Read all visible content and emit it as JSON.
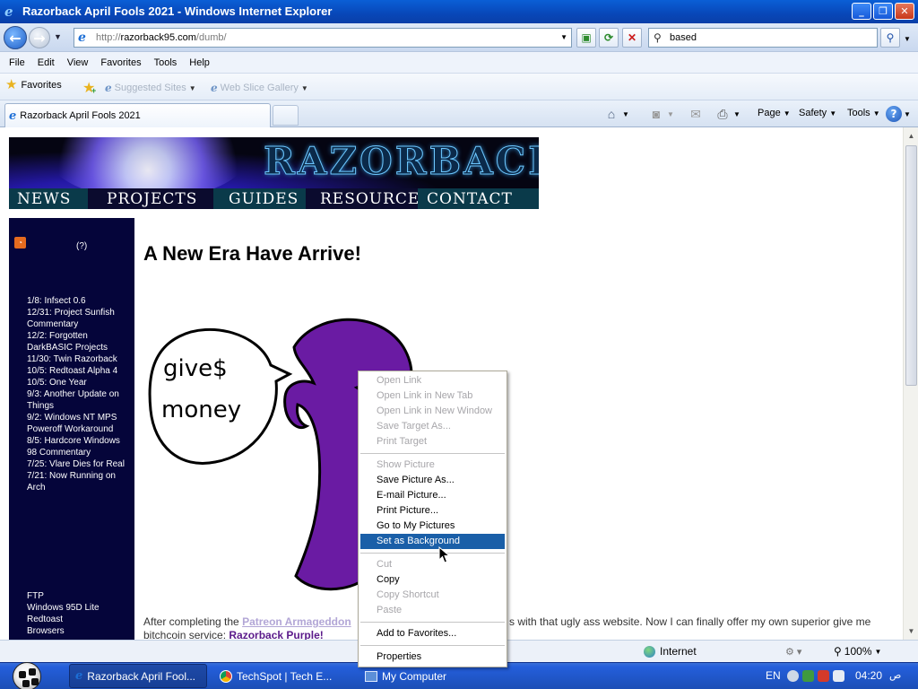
{
  "window": {
    "title": "Razorback April Fools 2021 - Windows Internet Explorer"
  },
  "address": {
    "url_prefix": "http://",
    "url_domain": "razorback95.com",
    "url_path": "/dumb/",
    "search_value": "based"
  },
  "menubar": [
    "File",
    "Edit",
    "View",
    "Favorites",
    "Tools",
    "Help"
  ],
  "favorites_bar": {
    "favorites_label": "Favorites",
    "links": [
      "Suggested Sites",
      "Web Slice Gallery"
    ]
  },
  "tab": {
    "title": "Razorback April Fools 2021"
  },
  "command_bar": {
    "page": "Page",
    "safety": "Safety",
    "tools": "Tools"
  },
  "page": {
    "banner": {
      "logo": "RAZORBACK",
      "nav": [
        "NEWS",
        "PROJECTS",
        "GUIDES",
        "RESOURCES",
        "CONTACT"
      ]
    },
    "sidebar": {
      "help": "(?)",
      "news": [
        "1/8: Infsect 0.6",
        "12/31: Project Sunfish Commentary",
        "12/2: Forgotten DarkBASIC Projects",
        "11/30: Twin Razorback",
        "10/5: Redtoast Alpha 4",
        "10/5: One Year",
        "9/3: Another Update on Things",
        "9/2: Windows NT MPS Poweroff Workaround",
        "8/5: Hardcore Windows 98 Commentary",
        "7/25: Vlare Dies for Real",
        "7/21: Now Running on Arch"
      ],
      "links": [
        "FTP",
        "Windows 95D Lite",
        "Redtoast",
        "Browsers"
      ]
    },
    "heading": "A New Era Have Arrive!",
    "comic_text": [
      "give$",
      "money"
    ],
    "paragraph": {
      "prefix": "After completing the",
      "link1": "Patreon Armageddon",
      "rest": "s with that ugly ass website. Now I can finally offer my own superior give me",
      "line2_prefix": "bitchcoin service:",
      "link2": "Razorback Purple!"
    }
  },
  "context_menu": {
    "items": [
      {
        "label": "Open Link",
        "disabled": true
      },
      {
        "label": "Open Link in New Tab",
        "disabled": true
      },
      {
        "label": "Open Link in New Window",
        "disabled": true
      },
      {
        "label": "Save Target As...",
        "disabled": true
      },
      {
        "label": "Print Target",
        "disabled": true
      },
      {
        "sep": true
      },
      {
        "label": "Show Picture",
        "disabled": true
      },
      {
        "label": "Save Picture As...",
        "disabled": false
      },
      {
        "label": "E-mail Picture...",
        "disabled": false
      },
      {
        "label": "Print Picture...",
        "disabled": false
      },
      {
        "label": "Go to My Pictures",
        "disabled": false
      },
      {
        "label": "Set as Background",
        "disabled": false,
        "selected": true
      },
      {
        "sep": true
      },
      {
        "label": "Cut",
        "disabled": true
      },
      {
        "label": "Copy",
        "disabled": false
      },
      {
        "label": "Copy Shortcut",
        "disabled": true
      },
      {
        "label": "Paste",
        "disabled": true
      },
      {
        "sep": true
      },
      {
        "label": "Add to Favorites...",
        "disabled": false
      },
      {
        "sep": true
      },
      {
        "label": "Properties",
        "disabled": false
      }
    ]
  },
  "status": {
    "zone": "Internet",
    "zoom": "100%"
  },
  "taskbar": {
    "items": [
      "Razorback April Fool...",
      "TechSpot | Tech E...",
      "My Computer"
    ],
    "lang": "EN",
    "time": "04:20",
    "ampm": "ص"
  }
}
